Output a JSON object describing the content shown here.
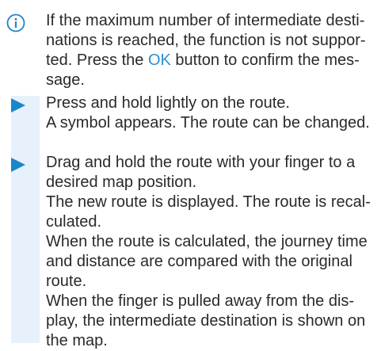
{
  "info_note": {
    "icon": "info-icon",
    "before_ok": "If the maximum number of intermediate desti­nations is reached, the function is not suppor­ted. Press the ",
    "ok_label": "OK",
    "after_ok": " button to confirm the mes­sage.",
    "accent_color": "#2b8fd1"
  },
  "steps": [
    {
      "marker": "triangle-right-icon",
      "instruction": "Press and hold lightly on the route.",
      "result": "A symbol appears. The route can be changed."
    },
    {
      "marker": "triangle-right-icon",
      "instruction": "Drag and hold the route with your finger to a desired map position.",
      "result": "The new route is displayed. The route is recal­culated."
    }
  ],
  "notes": [
    "When the route is calculated, the journey time and distance are compared with the original route.",
    "When the finger is pulled away from the dis­play, the intermediate destination is shown on the map."
  ],
  "colors": {
    "step_marker": "#1d86c9",
    "step_band": "#e6f1fb",
    "text": "#2a2a2a"
  }
}
